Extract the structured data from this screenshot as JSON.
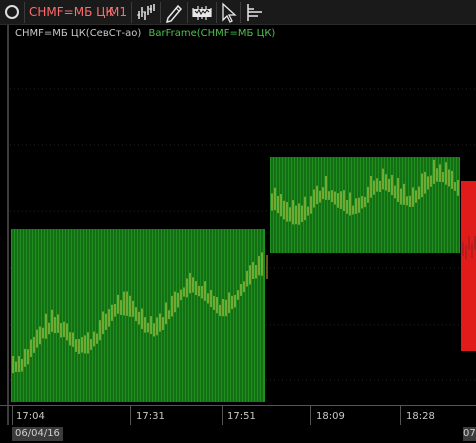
{
  "toolbar": {
    "symbol": "CHMF=МБ ЦК",
    "timeframe": "M1",
    "icons": [
      {
        "name": "chart-style-icon"
      },
      {
        "name": "pencil-icon"
      },
      {
        "name": "indicator-icon"
      },
      {
        "name": "cursor-icon"
      },
      {
        "name": "level-icon"
      }
    ]
  },
  "chart": {
    "instrument_label": "CHMF=МБ ЦК(СевСт-ао)",
    "indicator_label": "BarFrame(CHMF=МБ ЦК)",
    "colors": {
      "background": "#000000",
      "frame_up": "#1f8f1f",
      "frame_up_bars": "#0a4c0a",
      "frame_down": "#e11a1a",
      "grid": "#222222",
      "price_bars": "#c8c24a"
    }
  },
  "time_axis": {
    "labels": [
      "17:04",
      "17:31",
      "17:51",
      "18:09",
      "18:28"
    ],
    "date_label": "06/04/16",
    "date_label_2": "07"
  }
}
